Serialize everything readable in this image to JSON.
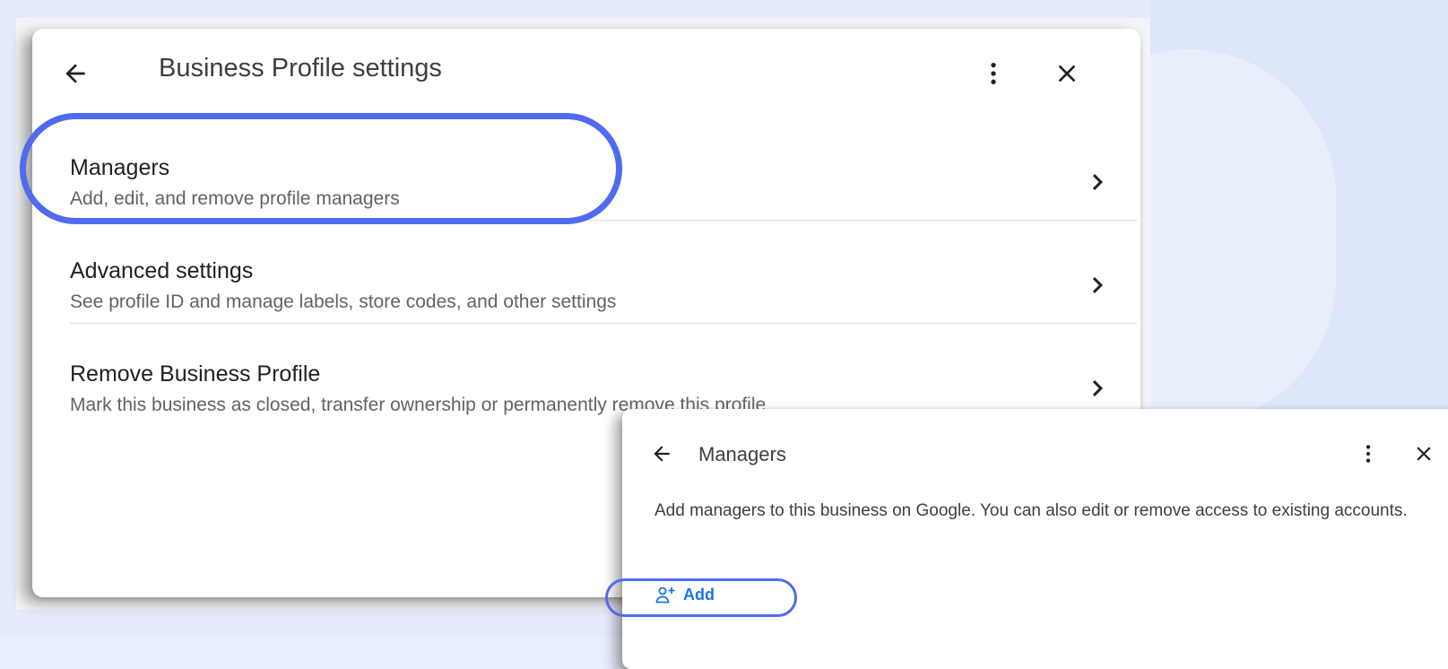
{
  "settings_dialog": {
    "title": "Business Profile settings",
    "back_icon": "arrow-back-icon",
    "more_icon": "more-vert-icon",
    "close_icon": "close-icon",
    "items": [
      {
        "label": "Managers",
        "description": "Add, edit, and remove profile managers",
        "icon": "chevron-right-icon"
      },
      {
        "label": "Advanced settings",
        "description": "See profile ID and manage labels, store codes, and other settings",
        "icon": "chevron-right-icon"
      },
      {
        "label": "Remove Business Profile",
        "description": "Mark this business as closed, transfer ownership or permanently remove this profile",
        "icon": "chevron-right-icon"
      }
    ]
  },
  "managers_dialog": {
    "title": "Managers",
    "back_icon": "arrow-back-icon",
    "more_icon": "more-vert-icon",
    "close_icon": "close-icon",
    "description": "Add managers to this business on Google. You can also edit or remove access to existing accounts.",
    "add_button": {
      "label": "Add",
      "icon": "person-add-icon"
    }
  },
  "colors": {
    "highlight": "#4f6bf0",
    "link": "#1a73e8",
    "text_primary": "#202124",
    "text_secondary": "#5f6368"
  }
}
